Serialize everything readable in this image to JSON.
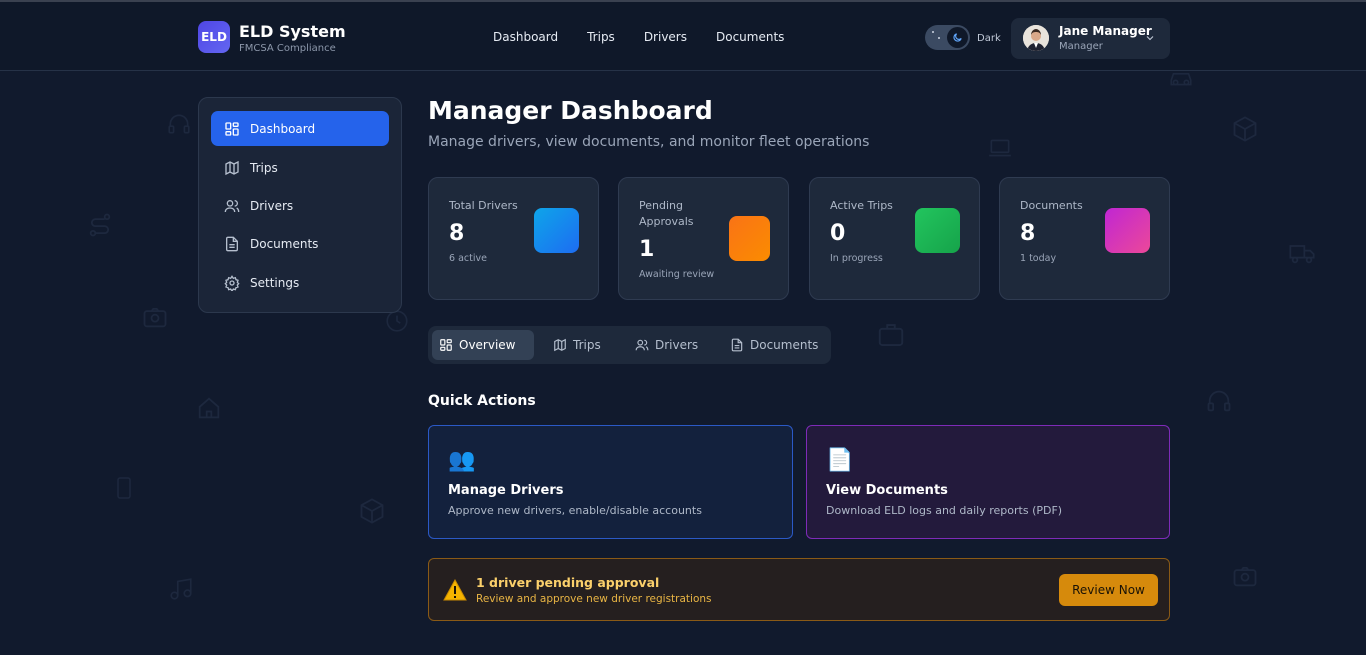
{
  "brand": {
    "logo_text": "ELD",
    "title": "ELD System",
    "subtitle": "FMCSA Compliance"
  },
  "topnav": [
    "Dashboard",
    "Trips",
    "Drivers",
    "Documents"
  ],
  "theme_toggle": {
    "label": "Dark",
    "state": "dark"
  },
  "user": {
    "name": "Jane Manager",
    "role": "Manager"
  },
  "sidebar": {
    "items": [
      {
        "label": "Dashboard",
        "icon": "dashboard-icon",
        "active": true
      },
      {
        "label": "Trips",
        "icon": "map-icon"
      },
      {
        "label": "Drivers",
        "icon": "users-icon"
      },
      {
        "label": "Documents",
        "icon": "document-icon"
      },
      {
        "label": "Settings",
        "icon": "gear-icon"
      }
    ]
  },
  "page": {
    "title": "Manager Dashboard",
    "subtitle": "Manage drivers, view documents, and monitor fleet operations"
  },
  "stats": [
    {
      "label": "Total Drivers",
      "value": "8",
      "note": "6 active",
      "color": "#0ea5e9"
    },
    {
      "label": "Pending Approvals",
      "value": "1",
      "note": "Awaiting review",
      "color": "#f97316"
    },
    {
      "label": "Active Trips",
      "value": "0",
      "note": "In progress",
      "color": "#22c55e"
    },
    {
      "label": "Documents",
      "value": "8",
      "note": "1 today",
      "color": "#d946ef"
    }
  ],
  "tabs": [
    {
      "label": "Overview",
      "icon": "dashboard-icon",
      "active": true
    },
    {
      "label": "Trips",
      "icon": "map-icon"
    },
    {
      "label": "Drivers",
      "icon": "users-icon"
    },
    {
      "label": "Documents",
      "icon": "document-icon"
    }
  ],
  "quick_actions": {
    "title": "Quick Actions",
    "items": [
      {
        "emoji": "👥",
        "title": "Manage Drivers",
        "desc": "Approve new drivers, enable/disable accounts"
      },
      {
        "emoji": "📄",
        "title": "View Documents",
        "desc": "Download ELD logs and daily reports (PDF)"
      }
    ]
  },
  "alert": {
    "icon": "warning-icon",
    "title": "1 driver pending approval",
    "subtitle": "Review and approve new driver registrations",
    "button": "Review Now"
  },
  "colors": {
    "accent": "#2563eb",
    "background": "#111a2d",
    "warning": "#d68a0c"
  }
}
